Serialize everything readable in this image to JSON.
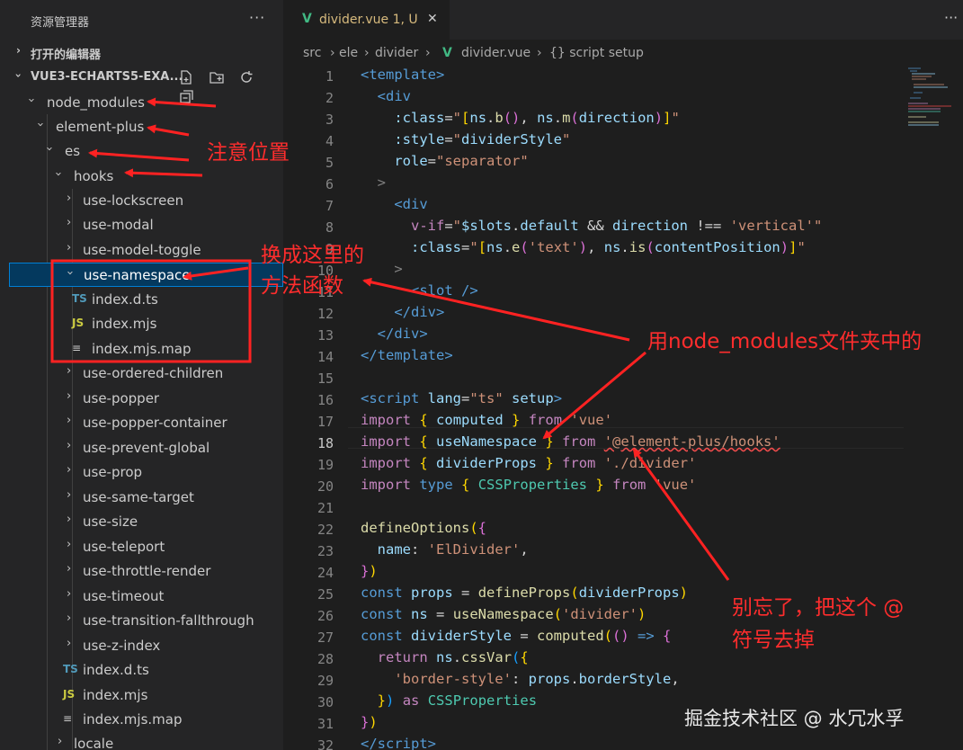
{
  "sidebar": {
    "title": "资源管理器",
    "more": "···",
    "open_editors": "打开的编辑器",
    "project": "VUE3-ECHARTS5-EXA...",
    "tree": [
      {
        "label": "node_modules",
        "type": "folder",
        "open": true
      },
      {
        "label": "element-plus",
        "type": "folder",
        "open": true
      },
      {
        "label": "es",
        "type": "folder",
        "open": true
      },
      {
        "label": "hooks",
        "type": "folder",
        "open": true
      },
      {
        "label": "use-lockscreen",
        "type": "folder",
        "open": false
      },
      {
        "label": "use-modal",
        "type": "folder",
        "open": false
      },
      {
        "label": "use-model-toggle",
        "type": "folder",
        "open": false
      },
      {
        "label": "use-namespace",
        "type": "folder",
        "open": true
      },
      {
        "label": "index.d.ts",
        "type": "ts"
      },
      {
        "label": "index.mjs",
        "type": "js"
      },
      {
        "label": "index.mjs.map",
        "type": "map"
      },
      {
        "label": "use-ordered-children",
        "type": "folder",
        "open": false
      },
      {
        "label": "use-popper",
        "type": "folder",
        "open": false
      },
      {
        "label": "use-popper-container",
        "type": "folder",
        "open": false
      },
      {
        "label": "use-prevent-global",
        "type": "folder",
        "open": false
      },
      {
        "label": "use-prop",
        "type": "folder",
        "open": false
      },
      {
        "label": "use-same-target",
        "type": "folder",
        "open": false
      },
      {
        "label": "use-size",
        "type": "folder",
        "open": false
      },
      {
        "label": "use-teleport",
        "type": "folder",
        "open": false
      },
      {
        "label": "use-throttle-render",
        "type": "folder",
        "open": false
      },
      {
        "label": "use-timeout",
        "type": "folder",
        "open": false
      },
      {
        "label": "use-transition-fallthrough",
        "type": "folder",
        "open": false
      },
      {
        "label": "use-z-index",
        "type": "folder",
        "open": false
      },
      {
        "label": "index.d.ts",
        "type": "ts"
      },
      {
        "label": "index.mjs",
        "type": "js"
      },
      {
        "label": "index.mjs.map",
        "type": "map"
      },
      {
        "label": "locale",
        "type": "folder",
        "open": false
      }
    ],
    "icon_ts": "TS",
    "icon_js": "JS",
    "icon_map": "≡"
  },
  "tab": {
    "name": "divider.vue 1, U",
    "close": "✕",
    "more": "···"
  },
  "breadcrumb": {
    "items": [
      "src",
      "ele",
      "divider",
      "divider.vue",
      "{} script setup"
    ],
    "sep": "›"
  },
  "editor": {
    "active_line": 18,
    "lines": [
      "1",
      "2",
      "3",
      "4",
      "5",
      "6",
      "7",
      "8",
      "9",
      "10",
      "11",
      "12",
      "13",
      "14",
      "15",
      "16",
      "17",
      "18",
      "19",
      "20",
      "21",
      "22",
      "23",
      "24",
      "25",
      "26",
      "27",
      "28",
      "29",
      "30",
      "31",
      "32"
    ]
  },
  "annotations": {
    "note_position": "注意位置",
    "replace_here_1": "换成这里的",
    "replace_here_2": "方法函数",
    "use_node_modules": "用node_modules文件夹中的",
    "dont_forget_1": "别忘了，把这个 @",
    "dont_forget_2": "符号去掉"
  },
  "watermark": "掘金技术社区 @ 水冗水孚"
}
